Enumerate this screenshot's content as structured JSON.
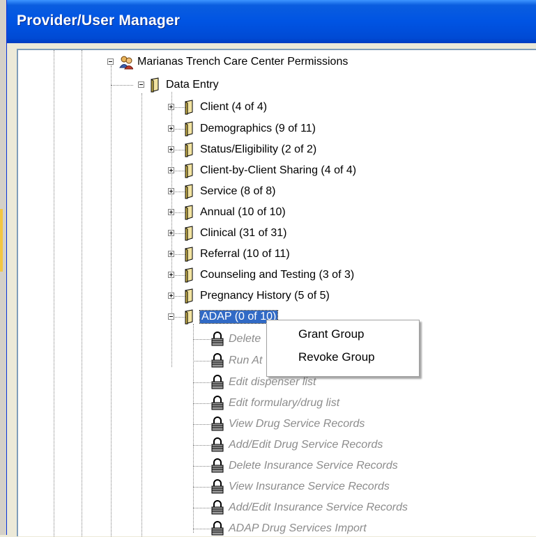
{
  "window": {
    "title": "Provider/User Manager"
  },
  "tree": {
    "root": {
      "label": "Marianas Trench Care Center Permissions",
      "icon": "users-icon"
    },
    "data_entry": {
      "label": "Data Entry",
      "icon": "folder-icon"
    },
    "categories": [
      {
        "label": "Client (4 of 4)"
      },
      {
        "label": "Demographics (9 of 11)"
      },
      {
        "label": "Status/Eligibility (2 of 2)"
      },
      {
        "label": "Client-by-Client Sharing (4 of 4)"
      },
      {
        "label": "Service (8 of 8)"
      },
      {
        "label": "Annual (10 of 10)"
      },
      {
        "label": "Clinical (31 of 31)"
      },
      {
        "label": "Referral (10 of 11)"
      },
      {
        "label": "Counseling and Testing (3 of 3)"
      },
      {
        "label": "Pregnancy History (5 of 5)"
      }
    ],
    "adap": {
      "label": "ADAP (0 of 10)",
      "selected": true
    },
    "adap_permissions": [
      {
        "label": "Delete"
      },
      {
        "label": "Run At"
      },
      {
        "label": "Edit dispenser list"
      },
      {
        "label": "Edit formulary/drug list"
      },
      {
        "label": "View Drug Service Records"
      },
      {
        "label": "Add/Edit Drug Service Records"
      },
      {
        "label": "Delete Insurance Service Records"
      },
      {
        "label": "View Insurance Service Records"
      },
      {
        "label": "Add/Edit Insurance Service Records"
      },
      {
        "label": "ADAP Drug Services Import"
      }
    ]
  },
  "context_menu": {
    "grant_label": "Grant Group",
    "revoke_label": "Revoke Group"
  },
  "colors": {
    "titlebar": "#0054e3",
    "selection": "#316ac5",
    "disabled_text": "#8c8c8c"
  }
}
